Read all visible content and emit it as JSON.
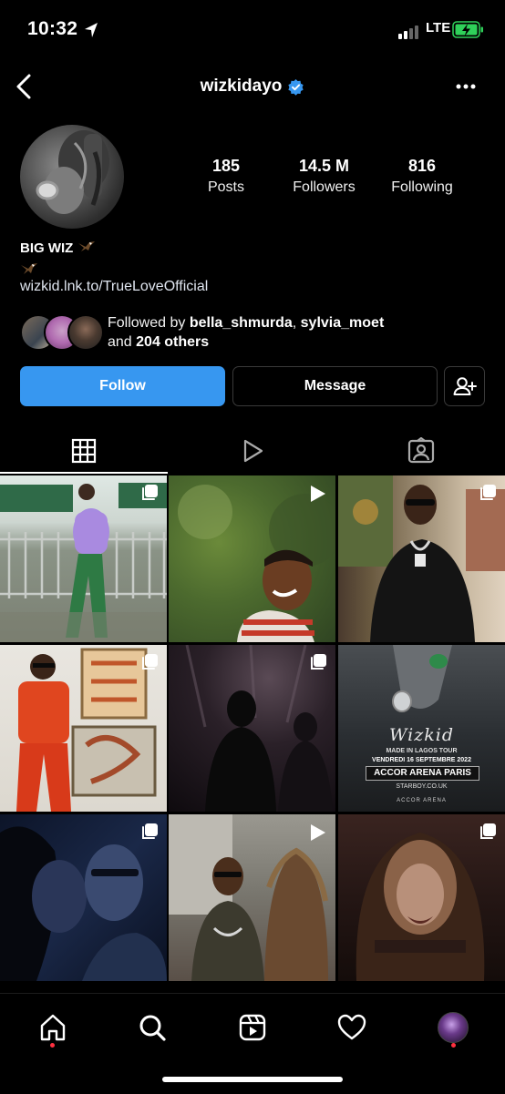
{
  "status_bar": {
    "time": "10:32",
    "network": "LTE"
  },
  "header": {
    "username": "wizkidayo",
    "verified": true
  },
  "stats": [
    {
      "value": "185",
      "label": "Posts"
    },
    {
      "value": "14.5 M",
      "label": "Followers"
    },
    {
      "value": "816",
      "label": "Following"
    }
  ],
  "bio": {
    "name": "BIG WIZ",
    "link": "wizkid.lnk.to/TrueLoveOfficial"
  },
  "followed_by": {
    "prefix": "Followed by ",
    "user1": "bella_shmurda",
    "sep": ", ",
    "user2": "sylvia_moet",
    "line2_prefix": "and ",
    "others": "204 others"
  },
  "actions": {
    "follow": "Follow",
    "message": "Message"
  },
  "tabs": [
    "grid-icon",
    "reels-icon",
    "tagged-icon"
  ],
  "grid": {
    "poster_text": {
      "artist": "Wizkid",
      "tour": "MADE IN LAGOS TOUR",
      "date": "VENDREDI 16 SEPTEMBRE 2022",
      "venue": "ACCOR ARENA PARIS",
      "site": "STARBOY.CO.UK",
      "arena_logo": "ACCOR ARENA"
    },
    "posts": [
      {
        "type": "carousel"
      },
      {
        "type": "reel"
      },
      {
        "type": "carousel"
      },
      {
        "type": "carousel"
      },
      {
        "type": "carousel"
      },
      {
        "type": "image"
      },
      {
        "type": "carousel"
      },
      {
        "type": "reel"
      },
      {
        "type": "reel"
      }
    ]
  },
  "colors": {
    "follow_button": "#3797f0",
    "verified": "#3797f0",
    "notification_dot": "#ff3040"
  }
}
